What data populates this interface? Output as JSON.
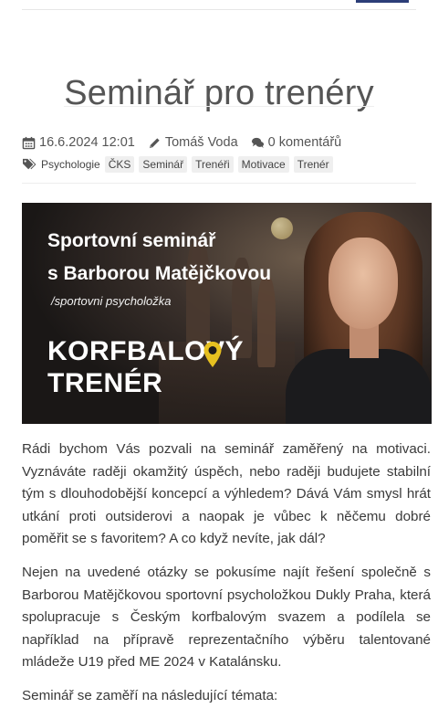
{
  "article": {
    "title": "Seminář pro trenéry",
    "date": "16.6.2024 12:01",
    "author": "Tomáš Voda",
    "comments": "0 komentářů",
    "tags": [
      "Psychologie",
      "ČKS",
      "Seminář",
      "Trenéři",
      "Motivace",
      "Trenér"
    ]
  },
  "hero": {
    "line1": "Sportovní seminář",
    "line2": "s Barborou Matějčkovou",
    "line3": "/sportovni psycholožka",
    "logo_line1": "KORFBALOVÝ",
    "logo_line2": "TRENÉR",
    "accent_color": "#e6c020"
  },
  "body": {
    "paragraph1": "Rádi bychom Vás pozvali na seminář zaměřený na motivaci. Vyznáváte raději okamžitý úspěch, nebo raději budujete stabilní tým s dlouhodobější koncepcí a výhledem? Dává Vám smysl hrát utkání proti outsiderovi a naopak je vůbec k něčemu dobré poměřit se s favoritem? A co když nevíte, jak dál?",
    "paragraph2": "Nejen na uvedené otázky se pokusíme najít řešení společně s Barborou Matějčkovou sportovní psycholožkou Dukly Praha, která spolupracuje s Českým korfbalovým svazem a podílela se například na přípravě reprezentačního výběru talentované mládeže U19 před ME 2024 v Katalánsku.",
    "paragraph3": "Seminář se zaměří na následující témata:"
  },
  "icons": {
    "date": "calendar-icon",
    "author": "pencil-icon",
    "comments": "comments-icon",
    "tags": "tags-icon"
  }
}
